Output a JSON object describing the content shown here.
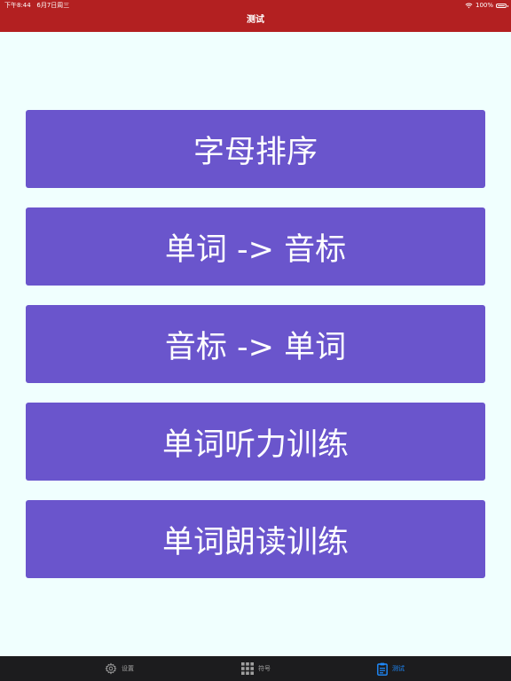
{
  "status_bar": {
    "time_date": "下午8:44   6月7日周三",
    "battery": "100%"
  },
  "header": {
    "title": "测试"
  },
  "menu": {
    "items": [
      {
        "label": "字母排序"
      },
      {
        "label": "单词 -> 音标"
      },
      {
        "label": "音标 -> 单词"
      },
      {
        "label": "单词听力训练"
      },
      {
        "label": "单词朗读训练"
      }
    ]
  },
  "tabs": [
    {
      "label": "设置",
      "icon": "gear-icon"
    },
    {
      "label": "符号",
      "icon": "grid-icon"
    },
    {
      "label": "测试",
      "icon": "clipboard-icon",
      "active": true
    }
  ],
  "colors": {
    "header": "#B32021",
    "button": "#6A55CC",
    "background": "#F0FFFE",
    "tabbar": "#1C1C1E",
    "active_tab": "#1E8BFF"
  }
}
